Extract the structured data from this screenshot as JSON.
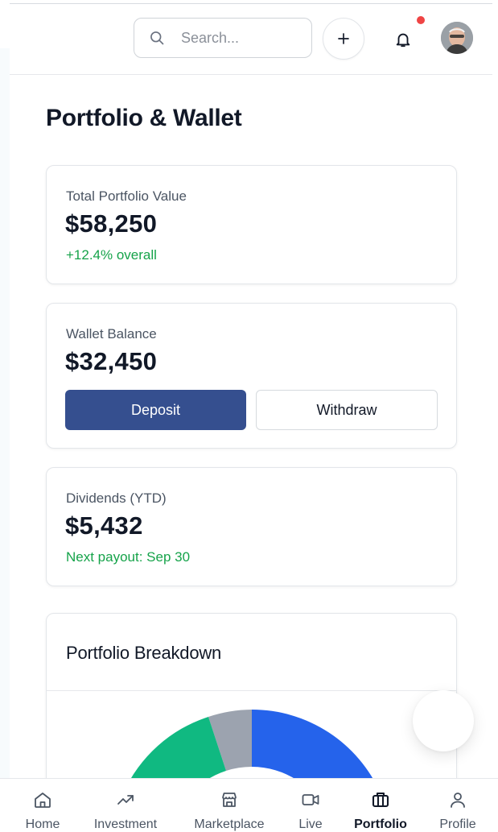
{
  "header": {
    "search_placeholder": "Search...",
    "icons": [
      "search-icon",
      "plus-icon",
      "bell-icon",
      "avatar"
    ],
    "notification_dot_color": "#ef4444"
  },
  "page": {
    "title": "Portfolio & Wallet"
  },
  "portfolio_card": {
    "label": "Total Portfolio Value",
    "value": "$58,250",
    "change": "+12.4% overall"
  },
  "wallet_card": {
    "label": "Wallet Balance",
    "value": "$32,450",
    "deposit_label": "Deposit",
    "withdraw_label": "Withdraw"
  },
  "dividends_card": {
    "label": "Dividends (YTD)",
    "value": "$5,432",
    "note": "Next payout: Sep 30"
  },
  "breakdown": {
    "title": "Portfolio Breakdown"
  },
  "chart_data": {
    "type": "pie",
    "segment_colors": [
      "#2563eb",
      "#9ca3af",
      "#10b981"
    ]
  },
  "nav": {
    "items": [
      {
        "label": "Home",
        "icon": "home-icon",
        "active": false
      },
      {
        "label": "Investment",
        "icon": "trend-up-icon",
        "active": false
      },
      {
        "label": "Marketplace",
        "icon": "store-icon",
        "active": false
      },
      {
        "label": "Live",
        "icon": "video-icon",
        "active": false
      },
      {
        "label": "Portfolio",
        "icon": "briefcase-icon",
        "active": true
      },
      {
        "label": "Profile",
        "icon": "user-icon",
        "active": false
      }
    ]
  },
  "colors": {
    "primary_button": "#354f8f",
    "positive_text": "#16a34a"
  }
}
